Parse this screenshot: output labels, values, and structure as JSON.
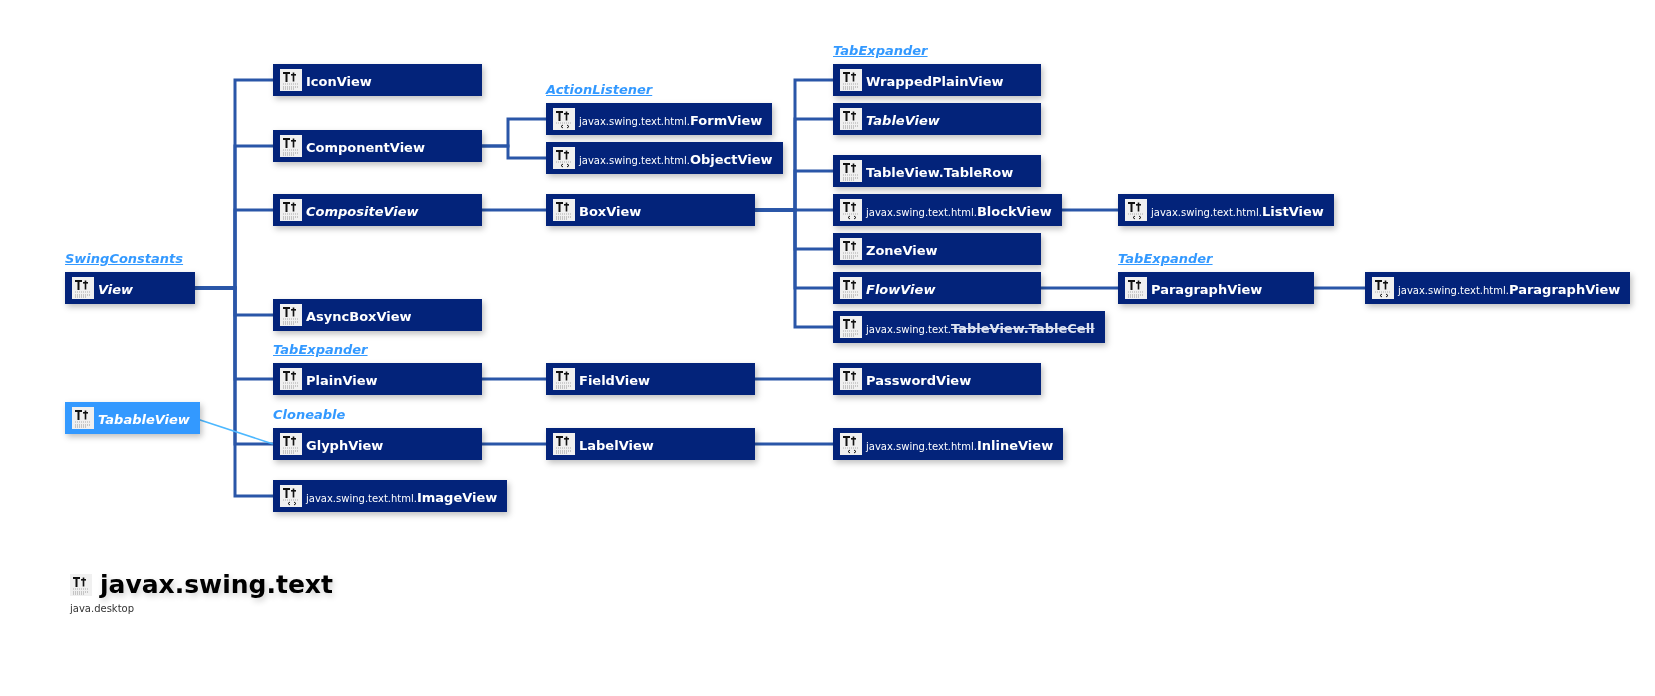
{
  "diagram": {
    "root": {
      "name": "View",
      "kind": "class",
      "html_icon": false,
      "italic": true,
      "deprecated": false,
      "interface_label": {
        "text": "SwingConstants",
        "underlined": true
      },
      "children": [
        {
          "name": "IconView",
          "kind": "class",
          "html_icon": false,
          "italic": false,
          "deprecated": false
        },
        {
          "name": "ComponentView",
          "kind": "class",
          "html_icon": false,
          "italic": false,
          "deprecated": false,
          "children": [
            {
              "name": "FormView",
              "package": "javax.swing.text.html.",
              "kind": "class",
              "html_icon": true,
              "italic": false,
              "deprecated": false,
              "interface_label": {
                "text": "ActionListener",
                "underlined": true
              }
            },
            {
              "name": "ObjectView",
              "package": "javax.swing.text.html.",
              "kind": "class",
              "html_icon": true,
              "italic": false,
              "deprecated": false
            }
          ]
        },
        {
          "name": "CompositeView",
          "kind": "class",
          "html_icon": false,
          "italic": true,
          "deprecated": false,
          "children": [
            {
              "name": "BoxView",
              "kind": "class",
              "html_icon": false,
              "italic": false,
              "deprecated": false,
              "children": [
                {
                  "name": "WrappedPlainView",
                  "kind": "class",
                  "html_icon": false,
                  "italic": false,
                  "deprecated": false,
                  "interface_label": {
                    "text": "TabExpander",
                    "underlined": true
                  }
                },
                {
                  "name": "TableView",
                  "kind": "class",
                  "html_icon": false,
                  "italic": true,
                  "deprecated": false
                },
                {
                  "name": "TableView.TableRow",
                  "kind": "class",
                  "html_icon": false,
                  "italic": false,
                  "deprecated": false
                },
                {
                  "name": "BlockView",
                  "package": "javax.swing.text.html.",
                  "kind": "class",
                  "html_icon": true,
                  "italic": false,
                  "deprecated": false,
                  "children": [
                    {
                      "name": "ListView",
                      "package": "javax.swing.text.html.",
                      "kind": "class",
                      "html_icon": true,
                      "italic": false,
                      "deprecated": false
                    }
                  ]
                },
                {
                  "name": "ZoneView",
                  "kind": "class",
                  "html_icon": false,
                  "italic": false,
                  "deprecated": false
                },
                {
                  "name": "FlowView",
                  "kind": "class",
                  "html_icon": false,
                  "italic": true,
                  "deprecated": false,
                  "children": [
                    {
                      "name": "ParagraphView",
                      "kind": "class",
                      "html_icon": false,
                      "italic": false,
                      "deprecated": false,
                      "interface_label": {
                        "text": "TabExpander",
                        "underlined": true
                      },
                      "children": [
                        {
                          "name": "ParagraphView",
                          "package": "javax.swing.text.html.",
                          "kind": "class",
                          "html_icon": true,
                          "italic": false,
                          "deprecated": false
                        }
                      ]
                    }
                  ]
                },
                {
                  "name": "TableView.TableCell",
                  "package": "javax.swing.text.",
                  "kind": "class",
                  "html_icon": false,
                  "italic": false,
                  "deprecated": true
                }
              ]
            }
          ]
        },
        {
          "name": "AsyncBoxView",
          "kind": "class",
          "html_icon": false,
          "italic": false,
          "deprecated": false
        },
        {
          "name": "PlainView",
          "kind": "class",
          "html_icon": false,
          "italic": false,
          "deprecated": false,
          "interface_label": {
            "text": "TabExpander",
            "underlined": true
          },
          "children": [
            {
              "name": "FieldView",
              "kind": "class",
              "html_icon": false,
              "italic": false,
              "deprecated": false,
              "children": [
                {
                  "name": "PasswordView",
                  "kind": "class",
                  "html_icon": false,
                  "italic": false,
                  "deprecated": false
                }
              ]
            }
          ]
        },
        {
          "name": "GlyphView",
          "kind": "class",
          "html_icon": false,
          "italic": false,
          "deprecated": false,
          "interface_label": {
            "text": "Cloneable",
            "underlined": false
          },
          "children": [
            {
              "name": "LabelView",
              "kind": "class",
              "html_icon": false,
              "italic": false,
              "deprecated": false,
              "children": [
                {
                  "name": "InlineView",
                  "package": "javax.swing.text.html.",
                  "kind": "class",
                  "html_icon": true,
                  "italic": false,
                  "deprecated": false
                }
              ]
            }
          ]
        },
        {
          "name": "ImageView",
          "package": "javax.swing.text.html.",
          "kind": "class",
          "html_icon": true,
          "italic": false,
          "deprecated": false
        }
      ]
    }
  },
  "side_nodes": [
    {
      "name": "TabableView",
      "kind": "interface",
      "html_icon": false,
      "italic": true,
      "deprecated": false
    }
  ],
  "title": {
    "text": "javax.swing.text",
    "module": "java.desktop"
  }
}
